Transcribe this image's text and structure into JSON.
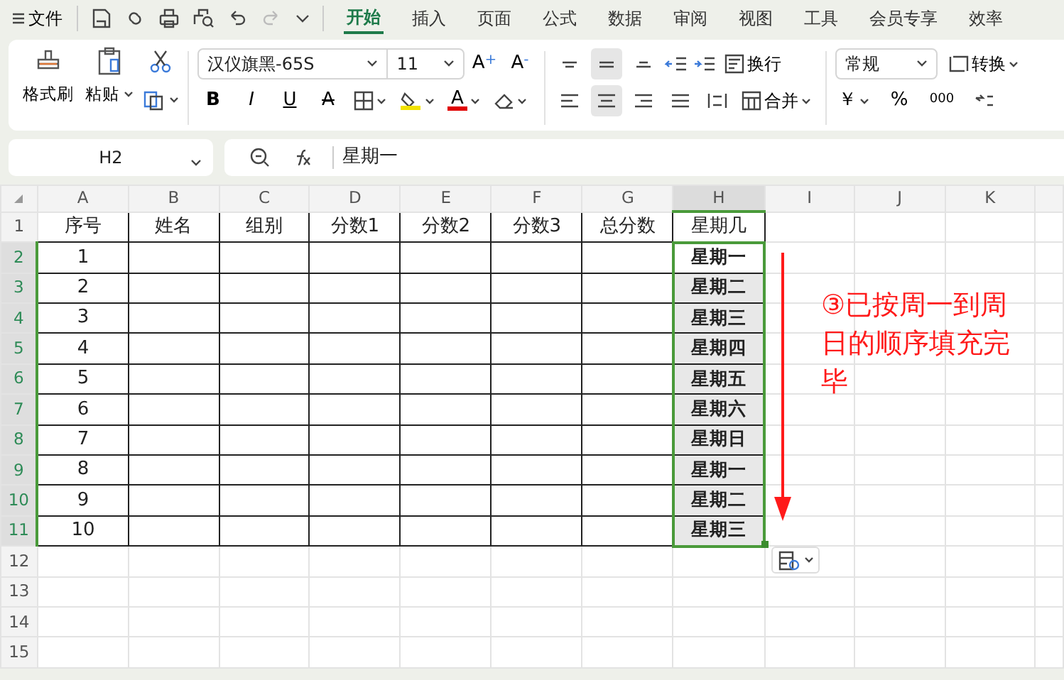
{
  "menu": {
    "file": "文件"
  },
  "tabs": [
    {
      "label": "开始",
      "selected": true
    },
    {
      "label": "插入",
      "selected": false
    },
    {
      "label": "页面",
      "selected": false
    },
    {
      "label": "公式",
      "selected": false
    },
    {
      "label": "数据",
      "selected": false
    },
    {
      "label": "审阅",
      "selected": false
    },
    {
      "label": "视图",
      "selected": false
    },
    {
      "label": "工具",
      "selected": false
    },
    {
      "label": "会员专享",
      "selected": false
    },
    {
      "label": "效率",
      "selected": false
    }
  ],
  "ribbon": {
    "format_painter": "格式刷",
    "paste": "粘贴",
    "font_name": "汉仪旗黑-65S",
    "font_size": "11",
    "grow_font": "A$^{+}$",
    "shrink_font": "A$^{-}$",
    "bold": "B",
    "italic": "I",
    "underline": "U",
    "strikethrough": "A",
    "font_color": "A",
    "wrap": "换行",
    "merge": "合并",
    "number_format": "常规",
    "convert": "转换",
    "currency": "￥",
    "percent": "%",
    "thousands": "000",
    "vertical_align": [
      {
        "selected": false
      },
      {
        "selected": true
      },
      {
        "selected": false
      }
    ],
    "horizontal_align": [
      {
        "selected": false
      },
      {
        "selected": true
      },
      {
        "selected": false
      },
      {
        "selected": false
      },
      {
        "selected": false
      }
    ]
  },
  "formula_bar": {
    "name_box": "H2",
    "formula": "星期一"
  },
  "sheet": {
    "columns": [
      {
        "label": "A",
        "selected": false
      },
      {
        "label": "B",
        "selected": false
      },
      {
        "label": "C",
        "selected": false
      },
      {
        "label": "D",
        "selected": false
      },
      {
        "label": "E",
        "selected": false
      },
      {
        "label": "F",
        "selected": false
      },
      {
        "label": "G",
        "selected": false
      },
      {
        "label": "H",
        "selected": true
      },
      {
        "label": "I",
        "selected": false
      },
      {
        "label": "J",
        "selected": false
      },
      {
        "label": "K",
        "selected": false
      }
    ],
    "rows": [
      {
        "header": "1",
        "selected": false,
        "headings": [
          "序号",
          "姓名",
          "组别",
          "分数1",
          "分数2",
          "分数3",
          "总分数",
          "星期几"
        ]
      },
      {
        "header": "2",
        "selected": true,
        "number": "1",
        "weekday": {
          "text": "星期一",
          "selected": true,
          "active": true
        }
      },
      {
        "header": "3",
        "selected": true,
        "number": "2",
        "weekday": {
          "text": "星期二",
          "selected": true,
          "active": false
        }
      },
      {
        "header": "4",
        "selected": true,
        "number": "3",
        "weekday": {
          "text": "星期三",
          "selected": true,
          "active": false
        }
      },
      {
        "header": "5",
        "selected": true,
        "number": "4",
        "weekday": {
          "text": "星期四",
          "selected": true,
          "active": false
        }
      },
      {
        "header": "6",
        "selected": true,
        "number": "5",
        "weekday": {
          "text": "星期五",
          "selected": true,
          "active": false
        }
      },
      {
        "header": "7",
        "selected": true,
        "number": "6",
        "weekday": {
          "text": "星期六",
          "selected": true,
          "active": false
        }
      },
      {
        "header": "8",
        "selected": true,
        "number": "7",
        "weekday": {
          "text": "星期日",
          "selected": true,
          "active": false
        }
      },
      {
        "header": "9",
        "selected": true,
        "number": "8",
        "weekday": {
          "text": "星期一",
          "selected": true,
          "active": false
        }
      },
      {
        "header": "10",
        "selected": true,
        "number": "9",
        "weekday": {
          "text": "星期二",
          "selected": true,
          "active": false
        }
      },
      {
        "header": "11",
        "selected": true,
        "number": "10",
        "weekday": {
          "text": "星期三",
          "selected": true,
          "active": false
        }
      },
      {
        "header": "12",
        "selected": false
      },
      {
        "header": "13",
        "selected": false
      },
      {
        "header": "14",
        "selected": false
      },
      {
        "header": "15",
        "selected": false
      }
    ]
  },
  "annotation": "③已按周一到周日的顺序填充完毕"
}
